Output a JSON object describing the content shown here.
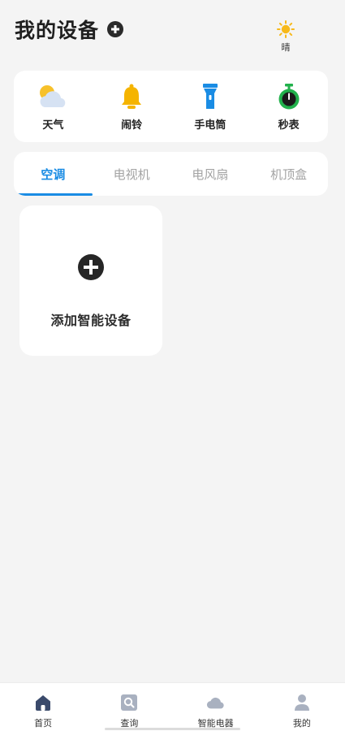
{
  "header": {
    "title": "我的设备",
    "weather_label": "晴"
  },
  "tools": [
    {
      "label": "天气",
      "icon": "weather-icon"
    },
    {
      "label": "闹铃",
      "icon": "bell-icon"
    },
    {
      "label": "手电筒",
      "icon": "flashlight-icon"
    },
    {
      "label": "秒表",
      "icon": "stopwatch-icon"
    }
  ],
  "tabs": [
    {
      "label": "空调",
      "active": true
    },
    {
      "label": "电视机",
      "active": false
    },
    {
      "label": "电风扇",
      "active": false
    },
    {
      "label": "机顶盒",
      "active": false
    }
  ],
  "add_device": {
    "label": "添加智能设备"
  },
  "bottom_nav": [
    {
      "label": "首页",
      "icon": "home-icon"
    },
    {
      "label": "查询",
      "icon": "search-icon"
    },
    {
      "label": "智能电器",
      "icon": "cloud-icon"
    },
    {
      "label": "我的",
      "icon": "user-icon"
    }
  ],
  "colors": {
    "accent": "#1a8ce4",
    "background": "#f4f4f4",
    "sun": "#f7b91a",
    "bell": "#f5b400",
    "flashlight": "#1a8ce4",
    "stopwatch": "#22b14c",
    "nav_active": "#3a4a6b",
    "nav_inactive": "#a9b1c0"
  }
}
